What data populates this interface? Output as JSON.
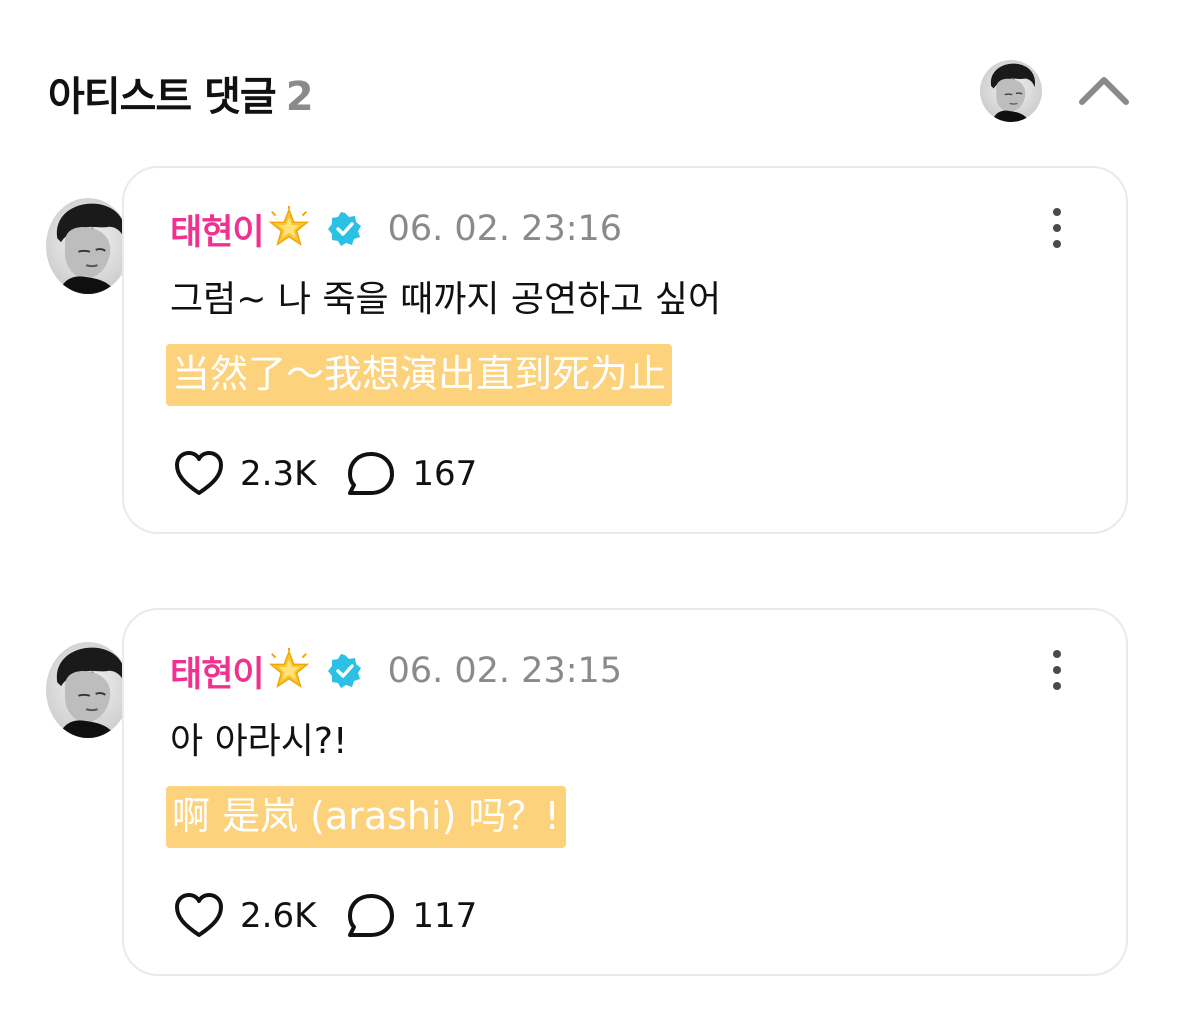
{
  "header": {
    "title": "아티스트 댓글",
    "count": "2"
  },
  "comments": [
    {
      "author": "태현이",
      "timestamp": "06. 02. 23:16",
      "text": "그럼~ 나 죽을 때까지 공연하고 싶어",
      "translation": "当然了～我想演出直到死为止",
      "likes": "2.3K",
      "replies": "167"
    },
    {
      "author": "태현이",
      "timestamp": "06. 02. 23:15",
      "text": "아 아라시?!",
      "translation": "啊 是岚 (arashi) 吗？!",
      "likes": "2.6K",
      "replies": "117"
    }
  ],
  "icons": {
    "badge": "star-icon",
    "verified": "verified-icon",
    "more": "more-vertical-icon",
    "like": "heart-icon",
    "reply": "comment-icon",
    "collapse": "chevron-up-icon"
  },
  "colors": {
    "author": "#f0318f",
    "translation_highlight": "#fcd27c",
    "verified": "#2bc0e4"
  }
}
